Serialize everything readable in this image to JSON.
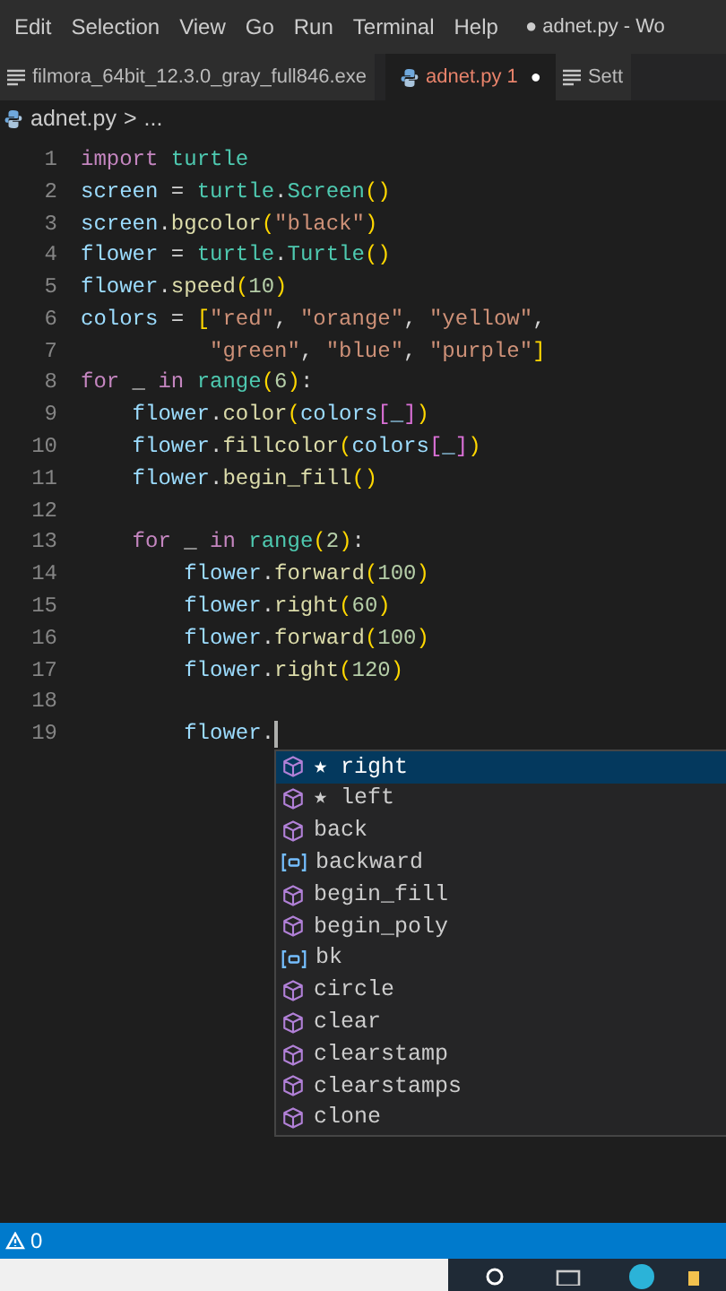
{
  "menu_bar": {
    "items": [
      "Edit",
      "Selection",
      "View",
      "Go",
      "Run",
      "Terminal",
      "Help"
    ],
    "window_title": "● adnet.py - Wo"
  },
  "tabs": [
    {
      "label": "filmora_64bit_12.3.0_gray_full846.exe",
      "kind": "text",
      "selected": false
    },
    {
      "label": "adnet.py 1",
      "kind": "python",
      "selected": true,
      "dirty_mark": "●"
    },
    {
      "label": "Sett",
      "kind": "text",
      "selected": false
    }
  ],
  "breadcrumb": {
    "file": "adnet.py",
    "separator": ">",
    "rest": "..."
  },
  "editor": {
    "lines": [
      {
        "number": "1",
        "tokens": [
          {
            "kind": "k",
            "text": "import "
          },
          {
            "kind": "m",
            "text": "turtle"
          }
        ]
      },
      {
        "number": "2",
        "tokens": [
          {
            "kind": "v",
            "text": "screen"
          },
          {
            "kind": "p",
            "text": " = "
          },
          {
            "kind": "m",
            "text": "turtle"
          },
          {
            "kind": "p",
            "text": "."
          },
          {
            "kind": "m",
            "text": "Screen"
          },
          {
            "kind": "b1",
            "text": "()"
          }
        ]
      },
      {
        "number": "3",
        "tokens": [
          {
            "kind": "v",
            "text": "screen"
          },
          {
            "kind": "p",
            "text": "."
          },
          {
            "kind": "f",
            "text": "bgcolor"
          },
          {
            "kind": "b1",
            "text": "("
          },
          {
            "kind": "s",
            "text": "\"black\""
          },
          {
            "kind": "b1",
            "text": ")"
          }
        ]
      },
      {
        "number": "4",
        "tokens": [
          {
            "kind": "v",
            "text": "flower"
          },
          {
            "kind": "p",
            "text": " = "
          },
          {
            "kind": "m",
            "text": "turtle"
          },
          {
            "kind": "p",
            "text": "."
          },
          {
            "kind": "m",
            "text": "Turtle"
          },
          {
            "kind": "b1",
            "text": "()"
          }
        ]
      },
      {
        "number": "5",
        "tokens": [
          {
            "kind": "v",
            "text": "flower"
          },
          {
            "kind": "p",
            "text": "."
          },
          {
            "kind": "f",
            "text": "speed"
          },
          {
            "kind": "b1",
            "text": "("
          },
          {
            "kind": "n",
            "text": "10"
          },
          {
            "kind": "b1",
            "text": ")"
          }
        ]
      },
      {
        "number": "6",
        "tokens": [
          {
            "kind": "v",
            "text": "colors"
          },
          {
            "kind": "p",
            "text": " = "
          },
          {
            "kind": "b1",
            "text": "["
          },
          {
            "kind": "s",
            "text": "\"red\""
          },
          {
            "kind": "p",
            "text": ", "
          },
          {
            "kind": "s",
            "text": "\"orange\""
          },
          {
            "kind": "p",
            "text": ", "
          },
          {
            "kind": "s",
            "text": "\"yellow\""
          },
          {
            "kind": "p",
            "text": ","
          }
        ]
      },
      {
        "number": "7",
        "tokens": [
          {
            "kind": "s",
            "text": "          \"green\""
          },
          {
            "kind": "p",
            "text": ", "
          },
          {
            "kind": "s",
            "text": "\"blue\""
          },
          {
            "kind": "p",
            "text": ", "
          },
          {
            "kind": "s",
            "text": "\"purple\""
          },
          {
            "kind": "b1",
            "text": "]"
          }
        ]
      },
      {
        "number": "8",
        "tokens": [
          {
            "kind": "k",
            "text": "for"
          },
          {
            "kind": "p",
            "text": " _ "
          },
          {
            "kind": "k",
            "text": "in "
          },
          {
            "kind": "m",
            "text": "range"
          },
          {
            "kind": "b1",
            "text": "("
          },
          {
            "kind": "n",
            "text": "6"
          },
          {
            "kind": "b1",
            "text": ")"
          },
          {
            "kind": "p",
            "text": ":"
          }
        ]
      },
      {
        "number": "9",
        "tokens": [
          {
            "kind": "v",
            "text": "    flower"
          },
          {
            "kind": "p",
            "text": "."
          },
          {
            "kind": "f",
            "text": "color"
          },
          {
            "kind": "b1",
            "text": "("
          },
          {
            "kind": "v",
            "text": "colors"
          },
          {
            "kind": "b2",
            "text": "["
          },
          {
            "kind": "v",
            "text": "_"
          },
          {
            "kind": "b2",
            "text": "]"
          },
          {
            "kind": "b1",
            "text": ")"
          }
        ]
      },
      {
        "number": "10",
        "tokens": [
          {
            "kind": "v",
            "text": "    flower"
          },
          {
            "kind": "p",
            "text": "."
          },
          {
            "kind": "f",
            "text": "fillcolor"
          },
          {
            "kind": "b1",
            "text": "("
          },
          {
            "kind": "v",
            "text": "colors"
          },
          {
            "kind": "b2",
            "text": "["
          },
          {
            "kind": "v",
            "text": "_"
          },
          {
            "kind": "b2",
            "text": "]"
          },
          {
            "kind": "b1",
            "text": ")"
          }
        ]
      },
      {
        "number": "11",
        "tokens": [
          {
            "kind": "v",
            "text": "    flower"
          },
          {
            "kind": "p",
            "text": "."
          },
          {
            "kind": "f",
            "text": "begin_fill"
          },
          {
            "kind": "b1",
            "text": "()"
          }
        ]
      },
      {
        "number": "12"
      },
      {
        "number": "13",
        "tokens": [
          {
            "kind": "k",
            "text": "    for"
          },
          {
            "kind": "p",
            "text": " _ "
          },
          {
            "kind": "k",
            "text": "in "
          },
          {
            "kind": "m",
            "text": "range"
          },
          {
            "kind": "b1",
            "text": "("
          },
          {
            "kind": "n",
            "text": "2"
          },
          {
            "kind": "b1",
            "text": ")"
          },
          {
            "kind": "p",
            "text": ":"
          }
        ]
      },
      {
        "number": "14",
        "tokens": [
          {
            "kind": "v",
            "text": "        flower"
          },
          {
            "kind": "p",
            "text": "."
          },
          {
            "kind": "f",
            "text": "forward"
          },
          {
            "kind": "b1",
            "text": "("
          },
          {
            "kind": "n",
            "text": "100"
          },
          {
            "kind": "b1",
            "text": ")"
          }
        ]
      },
      {
        "number": "15",
        "tokens": [
          {
            "kind": "v",
            "text": "        flower"
          },
          {
            "kind": "p",
            "text": "."
          },
          {
            "kind": "f",
            "text": "right"
          },
          {
            "kind": "b1",
            "text": "("
          },
          {
            "kind": "n",
            "text": "60"
          },
          {
            "kind": "b1",
            "text": ")"
          }
        ]
      },
      {
        "number": "16",
        "tokens": [
          {
            "kind": "v",
            "text": "        flower"
          },
          {
            "kind": "p",
            "text": "."
          },
          {
            "kind": "f",
            "text": "forward"
          },
          {
            "kind": "b1",
            "text": "("
          },
          {
            "kind": "n",
            "text": "100"
          },
          {
            "kind": "b1",
            "text": ")"
          }
        ]
      },
      {
        "number": "17",
        "tokens": [
          {
            "kind": "v",
            "text": "        flower"
          },
          {
            "kind": "p",
            "text": "."
          },
          {
            "kind": "f",
            "text": "right"
          },
          {
            "kind": "b1",
            "text": "("
          },
          {
            "kind": "n",
            "text": "120"
          },
          {
            "kind": "b1",
            "text": ")"
          }
        ]
      },
      {
        "number": "18"
      },
      {
        "number": "19",
        "tokens": [
          {
            "kind": "v",
            "text": "        flower"
          },
          {
            "kind": "p",
            "text": "."
          }
        ],
        "cursor": true
      }
    ]
  },
  "suggestions": [
    {
      "label": "★ right",
      "kind": "method",
      "selected": true
    },
    {
      "label": "★ left",
      "kind": "method",
      "selected": false
    },
    {
      "label": "back",
      "kind": "method",
      "selected": false
    },
    {
      "label": "backward",
      "kind": "variable",
      "selected": false
    },
    {
      "label": "begin_fill",
      "kind": "method",
      "selected": false
    },
    {
      "label": "begin_poly",
      "kind": "method",
      "selected": false
    },
    {
      "label": "bk",
      "kind": "variable",
      "selected": false
    },
    {
      "label": "circle",
      "kind": "method",
      "selected": false
    },
    {
      "label": "clear",
      "kind": "method",
      "selected": false
    },
    {
      "label": "clearstamp",
      "kind": "method",
      "selected": false
    },
    {
      "label": "clearstamps",
      "kind": "method",
      "selected": false
    },
    {
      "label": "clone",
      "kind": "method",
      "selected": false
    }
  ],
  "status_bar": {
    "warnings": "0"
  }
}
